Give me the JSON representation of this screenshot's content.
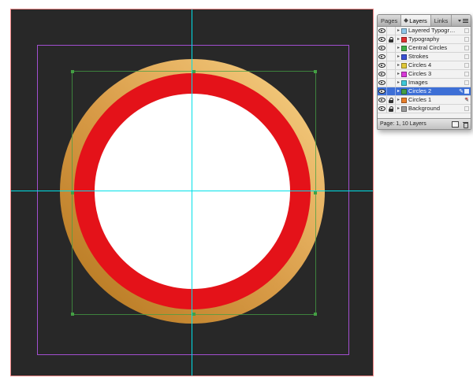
{
  "canvas": {
    "colors": {
      "page_fill": "#282828",
      "bleed_guide": "#f08585",
      "margin_guide": "#a24fd0",
      "ruler_guide": "#00e0e8",
      "ring_gold_light": "#f4cb7e",
      "ring_gold_mid": "#d99c48",
      "ring_gold_dark": "#b5771f",
      "ring_red": "#e41219",
      "inner_circle": "#ffffff",
      "selection_handle": "#44a044"
    }
  },
  "panel": {
    "tabs": [
      {
        "label": "Pages",
        "active": false
      },
      {
        "label": "Layers",
        "active": true
      },
      {
        "label": "Links",
        "active": false
      }
    ],
    "colors": {
      "selected_row": "#3d6fd6"
    },
    "layers": [
      {
        "name": "Layered Typography",
        "color": "#8fc7e8",
        "visible": true,
        "locked": false,
        "selected": false
      },
      {
        "name": "Typography",
        "color": "#e03030",
        "visible": true,
        "locked": true,
        "selected": false
      },
      {
        "name": "Central Circles",
        "color": "#3fae49",
        "visible": true,
        "locked": false,
        "selected": false
      },
      {
        "name": "Strokes",
        "color": "#3a52d4",
        "visible": true,
        "locked": false,
        "selected": false
      },
      {
        "name": "Circles 4",
        "color": "#e0c83a",
        "visible": true,
        "locked": false,
        "selected": false
      },
      {
        "name": "Circles 3",
        "color": "#d83ad8",
        "visible": true,
        "locked": false,
        "selected": false
      },
      {
        "name": "Images",
        "color": "#3ec8d8",
        "visible": true,
        "locked": false,
        "selected": false
      },
      {
        "name": "Circles 2",
        "color": "#44a044",
        "visible": true,
        "locked": false,
        "selected": true,
        "pen": true
      },
      {
        "name": "Circles 1",
        "color": "#e87f2a",
        "visible": true,
        "locked": true,
        "selected": false,
        "pen_crossed": true
      },
      {
        "name": "Background",
        "color": "#9a9a9a",
        "visible": true,
        "locked": true,
        "selected": false
      }
    ],
    "status": "Page: 1, 10 Layers"
  }
}
